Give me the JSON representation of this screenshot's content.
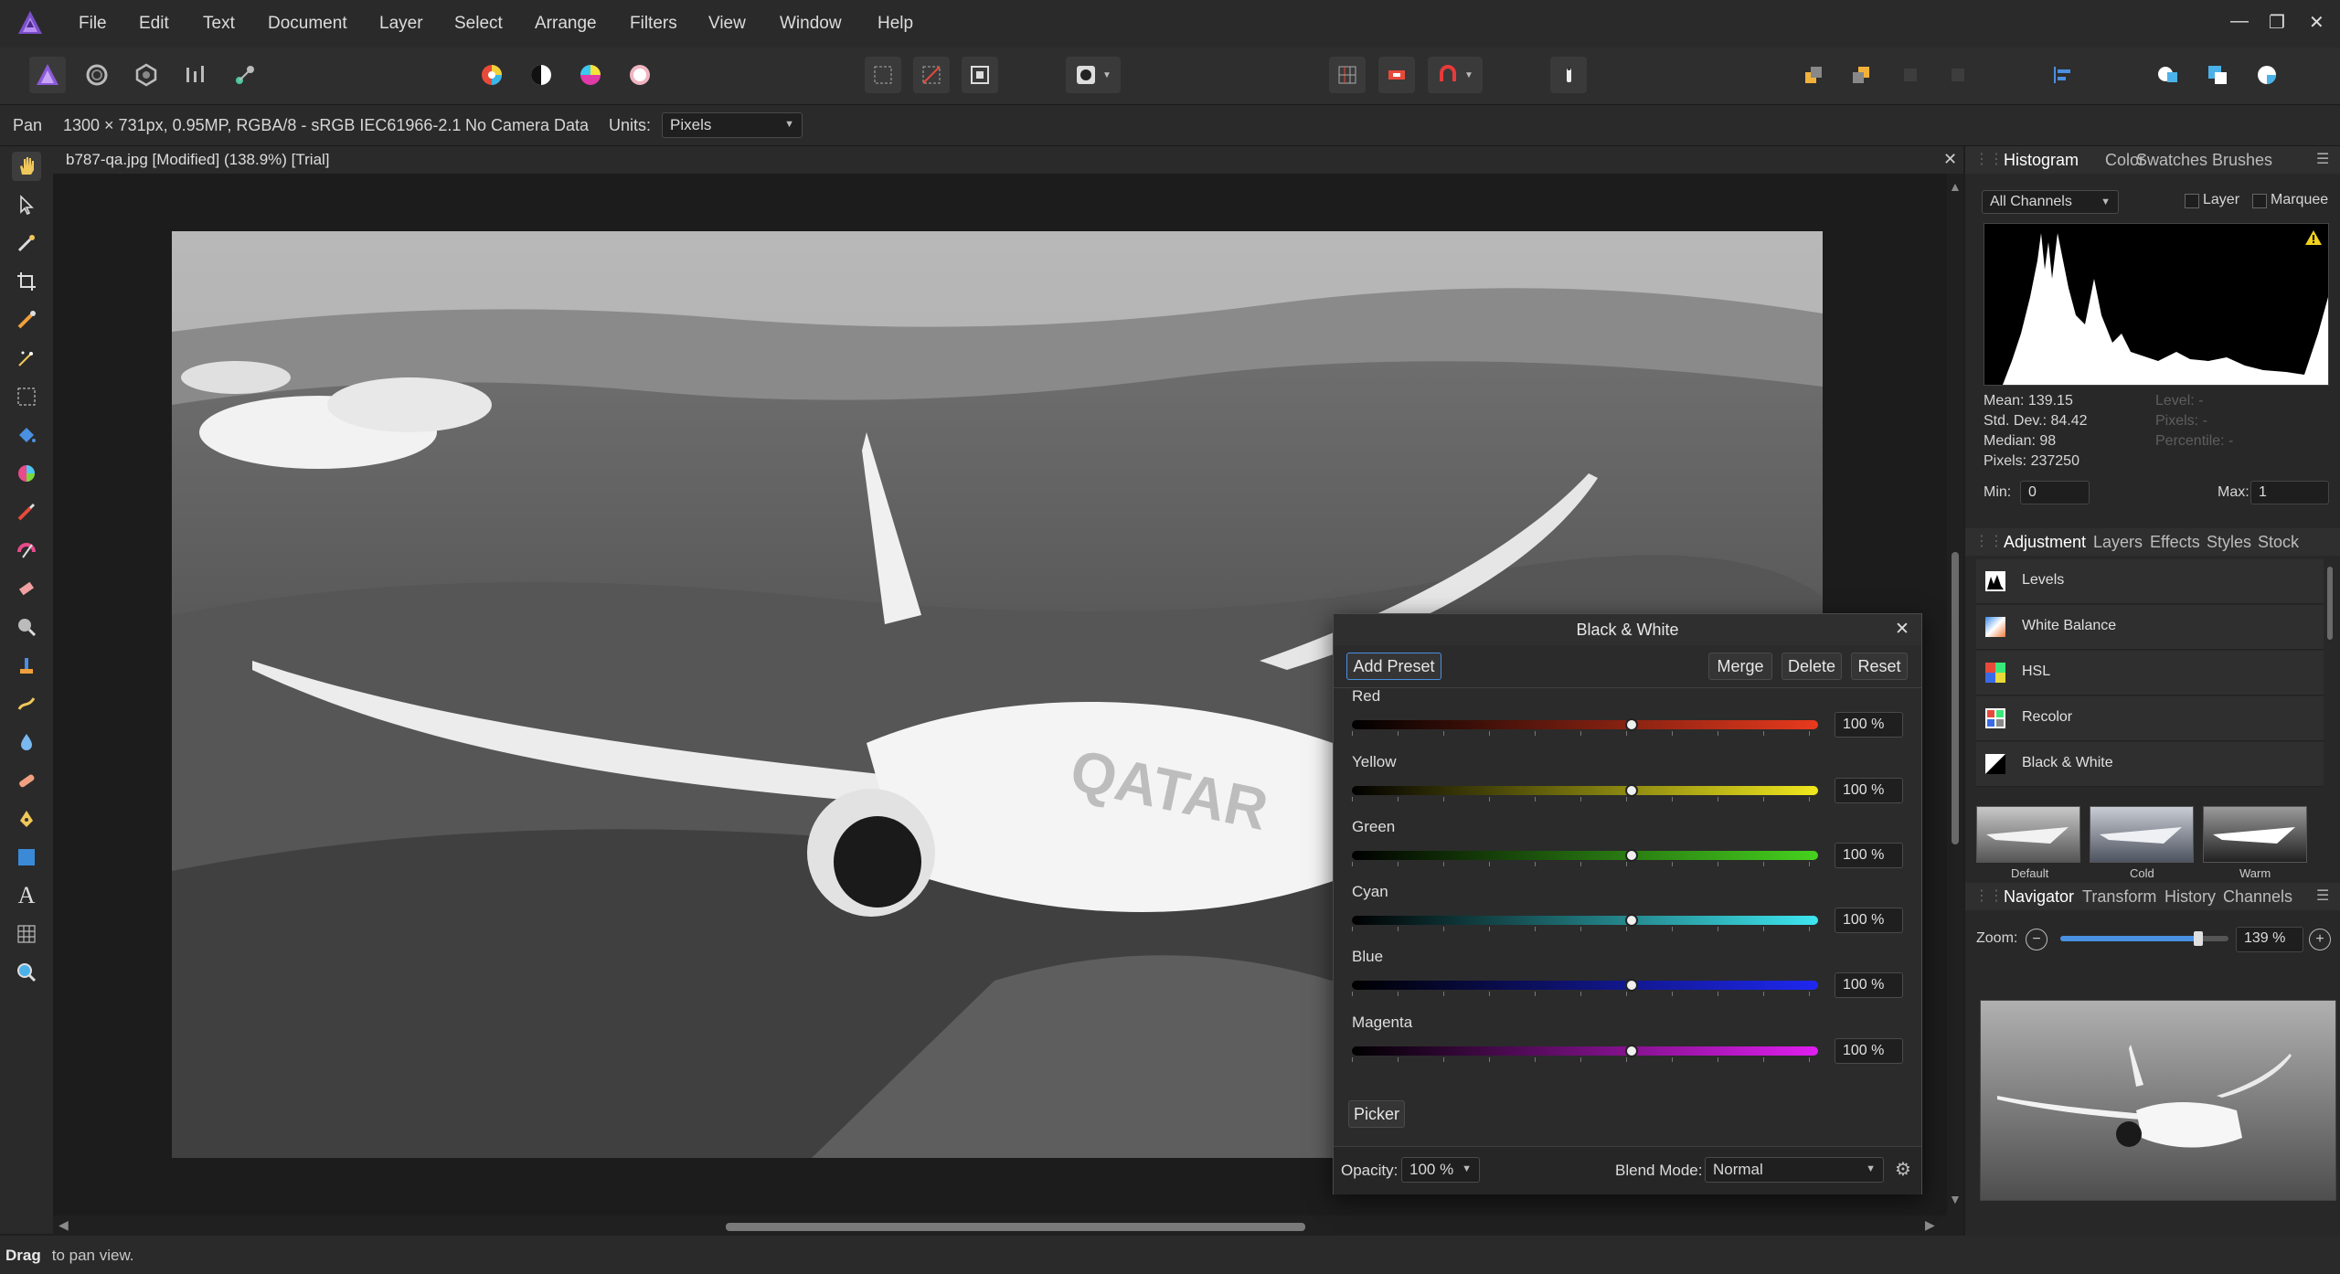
{
  "menu": {
    "items": [
      "File",
      "Edit",
      "Text",
      "Document",
      "Layer",
      "Select",
      "Arrange",
      "Filters",
      "View",
      "Window",
      "Help"
    ]
  },
  "context": {
    "tool": "Pan",
    "image_info": "1300 × 731px, 0.95MP, RGBA/8 - sRGB IEC61966-2.1",
    "camera": "No Camera Data",
    "units_label": "Units:",
    "units_value": "Pixels"
  },
  "document": {
    "tab_title": "b787-qa.jpg [Modified] (138.9%) [Trial]"
  },
  "status": {
    "bold": "Drag",
    "text": " to pan view."
  },
  "histogram_panel": {
    "tabs": [
      "Histogram",
      "Color",
      "Swatches",
      "Brushes"
    ],
    "channel": "All Channels",
    "layer_label": "Layer",
    "marquee_label": "Marquee",
    "mean": "Mean: 139.15",
    "std_dev": "Std. Dev.: 84.42",
    "median": "Median: 98",
    "pixels": "Pixels: 237250",
    "level": "Level: -",
    "pixels_dim": "Pixels: -",
    "percentile": "Percentile: -",
    "min_label": "Min:",
    "min_value": "0",
    "max_label": "Max:",
    "max_value": "1"
  },
  "adjustment_panel": {
    "tabs": [
      "Adjustment",
      "Layers",
      "Effects",
      "Styles",
      "Stock"
    ],
    "items": [
      "Levels",
      "White Balance",
      "HSL",
      "Recolor",
      "Black & White"
    ],
    "presets": [
      "Default",
      "Cold",
      "Warm"
    ]
  },
  "navigator_panel": {
    "tabs": [
      "Navigator",
      "Transform",
      "History",
      "Channels"
    ],
    "zoom_label": "Zoom:",
    "zoom_value": "139 %",
    "zoom_fraction": 0.82
  },
  "bw_dialog": {
    "title": "Black & White",
    "add_preset": "Add Preset",
    "merge": "Merge",
    "delete": "Delete",
    "reset": "Reset",
    "sliders": [
      {
        "label": "Red",
        "value": "100 %",
        "fraction": 0.6,
        "colors": [
          "#000000",
          "#e83a1e"
        ]
      },
      {
        "label": "Yellow",
        "value": "100 %",
        "fraction": 0.6,
        "colors": [
          "#000000",
          "#f0e81e"
        ]
      },
      {
        "label": "Green",
        "value": "100 %",
        "fraction": 0.6,
        "colors": [
          "#000000",
          "#46d21e"
        ]
      },
      {
        "label": "Cyan",
        "value": "100 %",
        "fraction": 0.6,
        "colors": [
          "#000000",
          "#3ee6f0"
        ]
      },
      {
        "label": "Blue",
        "value": "100 %",
        "fraction": 0.6,
        "colors": [
          "#000000",
          "#1e28f0"
        ]
      },
      {
        "label": "Magenta",
        "value": "100 %",
        "fraction": 0.6,
        "colors": [
          "#000000",
          "#e01ef0"
        ]
      }
    ],
    "picker": "Picker",
    "opacity_label": "Opacity:",
    "opacity_value": "100 %",
    "blend_label": "Blend Mode:",
    "blend_value": "Normal"
  },
  "photo_text": "QATAR",
  "colors": {
    "accent": "#4a90e2",
    "panel": "#282828",
    "dialog": "#2b2b2b"
  }
}
